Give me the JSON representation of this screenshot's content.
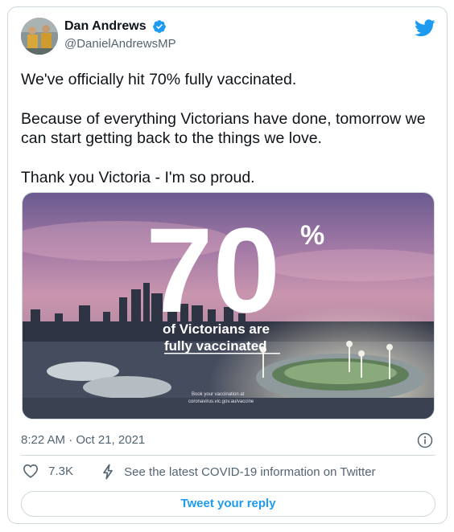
{
  "author": {
    "display_name": "Dan Andrews",
    "handle": "@DanielAndrewsMP"
  },
  "tweet": {
    "paragraphs": [
      "We've officially hit 70% fully vaccinated.",
      "Because of everything Victorians have done, tomorrow we can start getting back to the things we love.",
      "Thank you Victoria - I'm so proud."
    ]
  },
  "media": {
    "big_number": "70",
    "percent_sign": "%",
    "line1": "of Victorians are",
    "line2": "fully vaccinated",
    "small_line1": "Book your vaccination at",
    "small_line2": "coronavirus.vic.gov.au/vaccine"
  },
  "timestamp": "8:22 AM · Oct 21, 2021",
  "actions": {
    "like_count": "7.3K",
    "covid_info": "See the latest COVID-19 information on Twitter"
  },
  "reply_button": "Tweet your reply",
  "colors": {
    "accent": "#1d9bf0",
    "text": "#0f1419",
    "muted": "#536471",
    "border": "#cfd9de"
  },
  "icons": [
    "verified-badge-icon",
    "twitter-bird-icon",
    "info-icon",
    "heart-icon",
    "lightning-icon"
  ]
}
